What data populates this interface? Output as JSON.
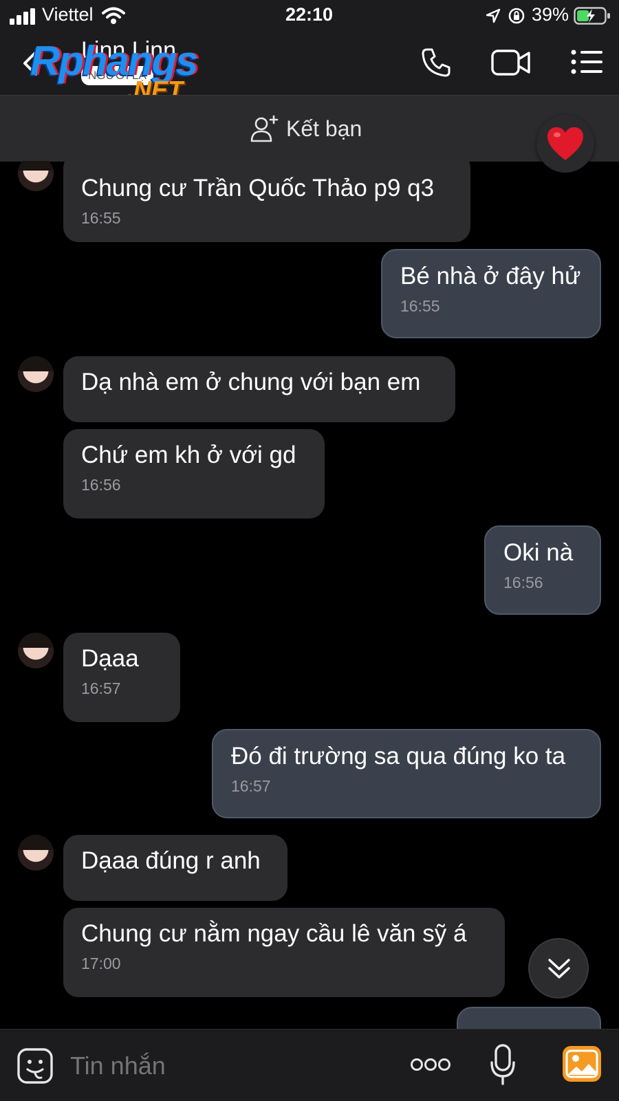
{
  "status": {
    "carrier": "Viettel",
    "time": "22:10",
    "battery": "39%"
  },
  "header": {
    "contact_name": "Linn Linn",
    "stranger_badge": "NGƯỜI LẠ",
    "watermark": {
      "brand": "Rphangs",
      "suffix": ".NET"
    },
    "icons": [
      "back-icon",
      "phone-icon",
      "video-call-icon",
      "menu-list-icon"
    ]
  },
  "friend_bar": {
    "label": "Kết bạn",
    "icon": "add-friend-icon",
    "reaction_icon": "heart-icon"
  },
  "messages": [
    {
      "dir": "in",
      "text": "Chung cư Trần Quốc Thảo p9 q3",
      "time": "16:55"
    },
    {
      "dir": "out",
      "text": "Bé nhà ở đây hử",
      "time": "16:55"
    },
    {
      "dir": "in",
      "text": "Dạ nhà em ở chung với bạn em",
      "time": ""
    },
    {
      "dir": "in",
      "text": "Chứ em kh ở với gd",
      "time": "16:56"
    },
    {
      "dir": "out",
      "text": "Oki nà",
      "time": "16:56"
    },
    {
      "dir": "in",
      "text": "Dạaa",
      "time": "16:57"
    },
    {
      "dir": "out",
      "text": "Đó đi trường sa qua đúng ko ta",
      "time": "16:57"
    },
    {
      "dir": "in",
      "text": "Dạaa đúng r anh",
      "time": ""
    },
    {
      "dir": "in",
      "text": "Chung cư nằm ngay cầu lê văn sỹ á",
      "time": "17:00"
    }
  ],
  "input": {
    "placeholder": "Tin nhắn",
    "icons": [
      "sticker-icon",
      "more-icon",
      "microphone-icon",
      "image-icon"
    ]
  },
  "scroll_down_icon": "double-chevron-down-icon",
  "colors": {
    "background": "#000000",
    "incoming_bubble": "#2c2c2e",
    "outgoing_bubble": "#3a414c",
    "accent_image": "#f59a23",
    "heart": "#e0192b"
  }
}
